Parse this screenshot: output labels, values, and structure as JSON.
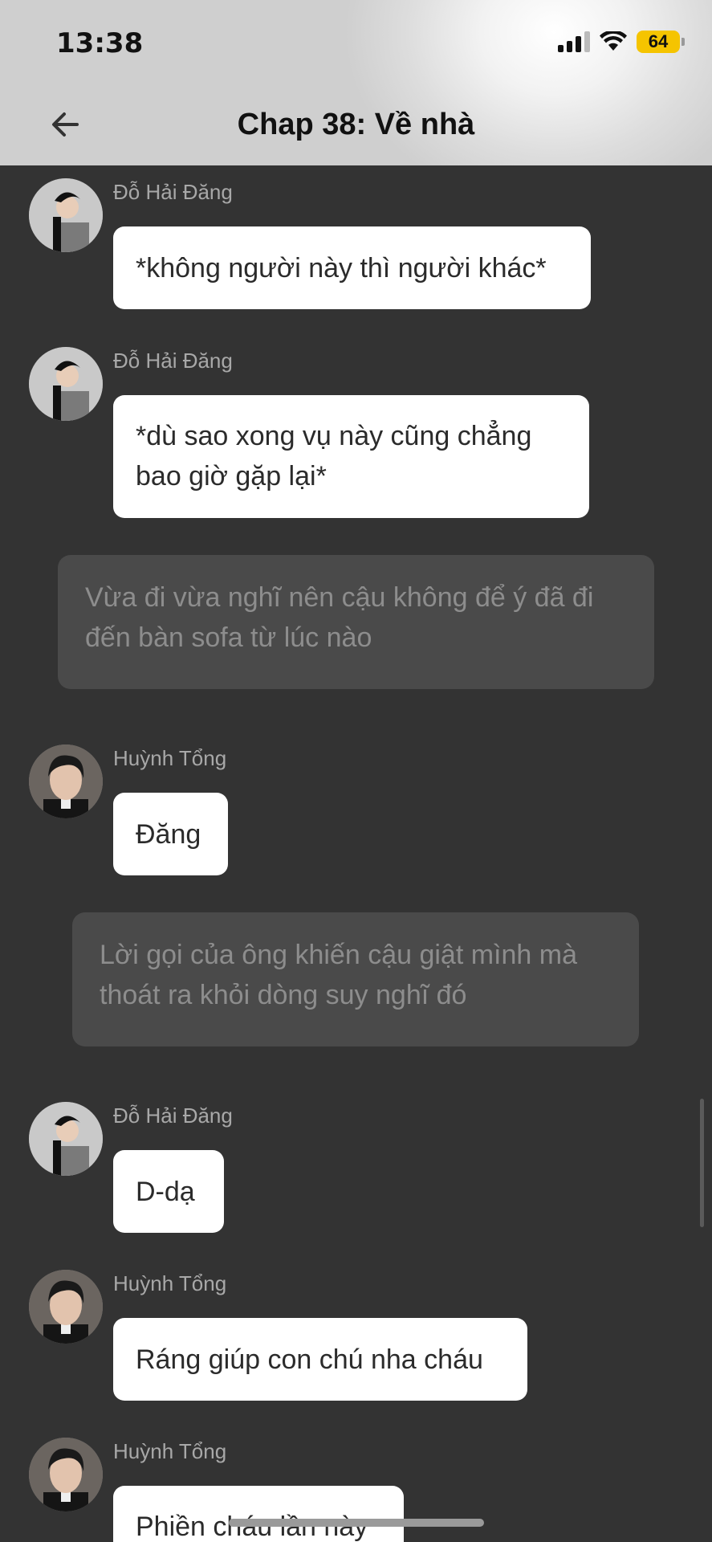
{
  "status_bar": {
    "time": "13:38",
    "battery": "64"
  },
  "header": {
    "title": "Chap 38: Về nhà"
  },
  "colors": {
    "chat_background": "#333333",
    "bubble": "#ffffff",
    "narration": "#4a4a4a",
    "battery": "#f5c400"
  },
  "messages": [
    {
      "sender": "Đỗ Hải Đăng",
      "lines": [
        "*không người này thì người khác*"
      ]
    },
    {
      "sender": "Đỗ Hải Đăng",
      "lines": [
        "*dù sao xong vụ này cũng chẳng",
        "bao giờ gặp lại*"
      ]
    },
    {
      "narration": [
        "Vừa đi vừa nghĩ nên cậu không để ý đã đi",
        "đến bàn sofa từ lúc nào"
      ]
    },
    {
      "sender": "Huỳnh Tổng",
      "lines": [
        "Đăng"
      ]
    },
    {
      "narration": [
        "Lời gọi của ông khiến cậu giật mình mà",
        "thoát ra khỏi dòng suy nghĩ đó"
      ]
    },
    {
      "sender": "Đỗ Hải Đăng",
      "lines": [
        "D-dạ"
      ]
    },
    {
      "sender": "Huỳnh Tổng",
      "lines": [
        "Ráng giúp con chú nha cháu"
      ]
    },
    {
      "sender": "Huỳnh Tổng",
      "lines": [
        "Phiền cháu lần này"
      ]
    }
  ]
}
